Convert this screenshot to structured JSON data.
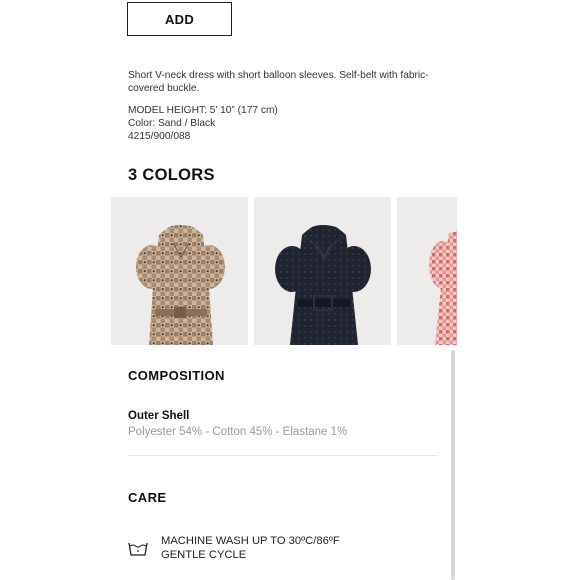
{
  "add_button": {
    "label": "ADD"
  },
  "product": {
    "description": "Short V-neck dress with short balloon sleeves. Self-belt with fabric-covered buckle.",
    "model_height": "MODEL HEIGHT: 5’ 10” (177 cm)",
    "color": "Color: Sand / Black",
    "reference": "4215/900/088"
  },
  "colors": {
    "title": "3 COLORS",
    "swatches": [
      {
        "name": "sand-gingham",
        "fabric": "#c4a88d",
        "accent": "#5a3d2e"
      },
      {
        "name": "black-dot",
        "fabric": "#1f2430",
        "accent": "#3a3f4c"
      },
      {
        "name": "red-gingham",
        "fabric": "#e3a9a6",
        "accent": "#c94b4b"
      }
    ]
  },
  "composition": {
    "title": "COMPOSITION",
    "outer_shell_label": "Outer Shell",
    "outer_shell_value": "Polyester 54% - Cotton 45% - Elastane 1%"
  },
  "care": {
    "title": "CARE",
    "instruction_line1": "MACHINE WASH UP TO 30ºC/86ºF",
    "instruction_line2": "GENTLE CYCLE",
    "icon": "wash-tub-icon"
  }
}
